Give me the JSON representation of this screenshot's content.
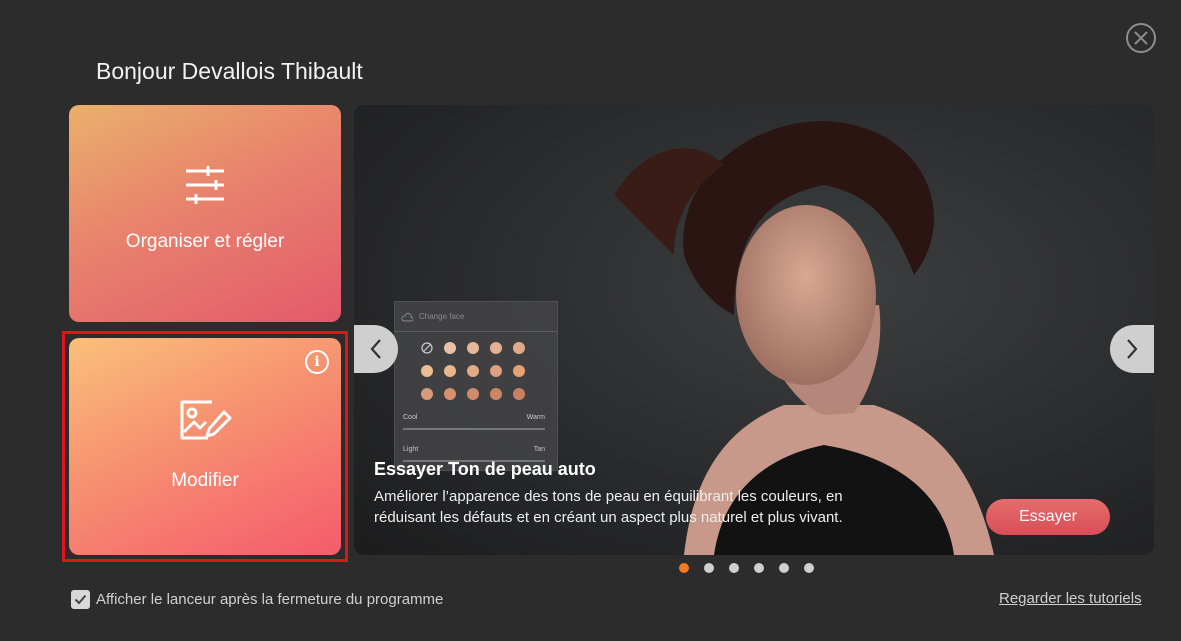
{
  "greeting": "Bonjour Devallois Thibault",
  "tiles": {
    "organize": {
      "label": "Organiser et régler",
      "icon": "sliders-icon"
    },
    "edit": {
      "label": "Modifier",
      "icon": "image-edit-icon"
    }
  },
  "banner": {
    "title": "Essayer Ton de peau auto",
    "description": "Améliorer l’apparence des tons de peau en équilibrant les couleurs, en réduisant les défauts et en créant un aspect plus naturel et plus vivant.",
    "try_button": "Essayer",
    "panel": {
      "title": "Change face",
      "cool": "Cool",
      "warm": "Warm",
      "light": "Light",
      "tan": "Tan"
    }
  },
  "carousel": {
    "total": 6,
    "active_index": 0
  },
  "footer": {
    "checkbox_label": "Afficher le lanceur après la fermeture du programme",
    "checkbox_checked": true,
    "tutorials_link": "Regarder les tutoriels"
  },
  "colors": {
    "background": "#2c2c2c",
    "accent_dot": "#f07b22",
    "try_button": "#d94e57",
    "highlight": "#e0151b"
  }
}
